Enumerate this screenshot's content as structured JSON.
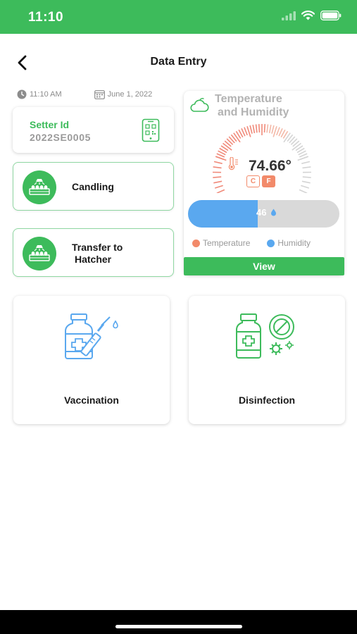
{
  "status_bar": {
    "time": "11:10"
  },
  "header": {
    "title": "Data Entry"
  },
  "meta": {
    "time": "11:10 AM",
    "date": "June 1, 2022"
  },
  "setter": {
    "label": "Setter Id",
    "value": "2022SE0005"
  },
  "actions": [
    {
      "label": "Candling"
    },
    {
      "label_line1": "Transfer to",
      "label_line2": "Hatcher"
    }
  ],
  "temperature": {
    "title_line1": "Temperature",
    "title_line2": "and Humidity",
    "value": "74.66°",
    "unit_c": "C",
    "unit_f": "F",
    "selected_unit": "F",
    "humidity_value": "46",
    "humidity_fraction": 0.46,
    "legend_temperature": "Temperature",
    "legend_humidity": "Humidity",
    "view_label": "View",
    "temp_color": "#f28a6a",
    "humidity_color": "#5aa8ef"
  },
  "tiles": [
    {
      "label": "Vaccination",
      "icon": "vaccine-icon"
    },
    {
      "label": "Disinfection",
      "icon": "disinfectant-icon"
    }
  ],
  "colors": {
    "brand": "#3dbb5b",
    "accent_orange": "#f28a6a",
    "humidity_blue": "#5aa8ef"
  }
}
